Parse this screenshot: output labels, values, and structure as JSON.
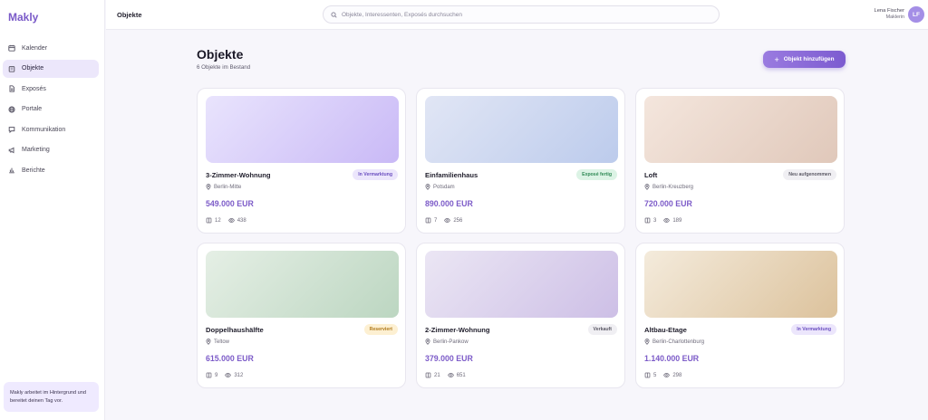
{
  "app": {
    "logo": "Makly"
  },
  "sidebar": {
    "items": [
      {
        "label": "Kalender",
        "icon": "calendar-icon",
        "active": false
      },
      {
        "label": "Objekte",
        "icon": "building-icon",
        "active": true
      },
      {
        "label": "Exposés",
        "icon": "document-icon",
        "active": false
      },
      {
        "label": "Portale",
        "icon": "globe-icon",
        "active": false
      },
      {
        "label": "Kommunikation",
        "icon": "chat-icon",
        "active": false
      },
      {
        "label": "Marketing",
        "icon": "megaphone-icon",
        "active": false
      },
      {
        "label": "Berichte",
        "icon": "chart-icon",
        "active": false
      }
    ],
    "note": "Makly arbeitet im Hintergrund und bereitet deinen Tag vor."
  },
  "topbar": {
    "title": "Objekte",
    "search_placeholder": "Objekte, Interessenten, Exposés durchsuchen",
    "user_name": "Lena Fischer",
    "user_role": "Maklerin",
    "user_initials": "LF"
  },
  "page": {
    "title": "Objekte",
    "subtitle": "6 Objekte im Bestand",
    "add_button": "Objekt hinzufügen"
  },
  "listings": [
    {
      "title": "3-Zimmer-Wohnung",
      "location": "Berlin-Mitte",
      "price": "549.000 EUR",
      "status": "In Vermarktung",
      "status_fg": "#6b4fc0",
      "status_bg": "#ece6fc",
      "docs": "12",
      "views": "438",
      "img_from": "#e9e4fd",
      "img_to": "#c9b9f6"
    },
    {
      "title": "Einfamilienhaus",
      "location": "Potsdam",
      "price": "890.000 EUR",
      "status": "Exposé fertig",
      "status_fg": "#2f8a55",
      "status_bg": "#dcf3e5",
      "docs": "7",
      "views": "256",
      "img_from": "#e1e6f5",
      "img_to": "#bccbec"
    },
    {
      "title": "Loft",
      "location": "Berlin-Kreuzberg",
      "price": "720.000 EUR",
      "status": "Neu aufgenommen",
      "status_fg": "#5c5a66",
      "status_bg": "#f0eff3",
      "docs": "3",
      "views": "189",
      "img_from": "#f4e6dd",
      "img_to": "#e0c8ba"
    },
    {
      "title": "Doppelhaushälfte",
      "location": "Teltow",
      "price": "615.000 EUR",
      "status": "Reserviert",
      "status_fg": "#b07a1c",
      "status_bg": "#fdf0d2",
      "docs": "9",
      "views": "312",
      "img_from": "#e5efe5",
      "img_to": "#bcd6c1"
    },
    {
      "title": "2-Zimmer-Wohnung",
      "location": "Berlin-Pankow",
      "price": "379.000 EUR",
      "status": "Verkauft",
      "status_fg": "#5c5a66",
      "status_bg": "#f0eff3",
      "docs": "21",
      "views": "651",
      "img_from": "#ebe6f4",
      "img_to": "#cdbfe6"
    },
    {
      "title": "Altbau-Etage",
      "location": "Berlin-Charlottenburg",
      "price": "1.140.000 EUR",
      "status": "In Vermarktung",
      "status_fg": "#6b4fc0",
      "status_bg": "#ece6fc",
      "docs": "5",
      "views": "298",
      "img_from": "#f4ebdc",
      "img_to": "#dcc29c"
    }
  ]
}
